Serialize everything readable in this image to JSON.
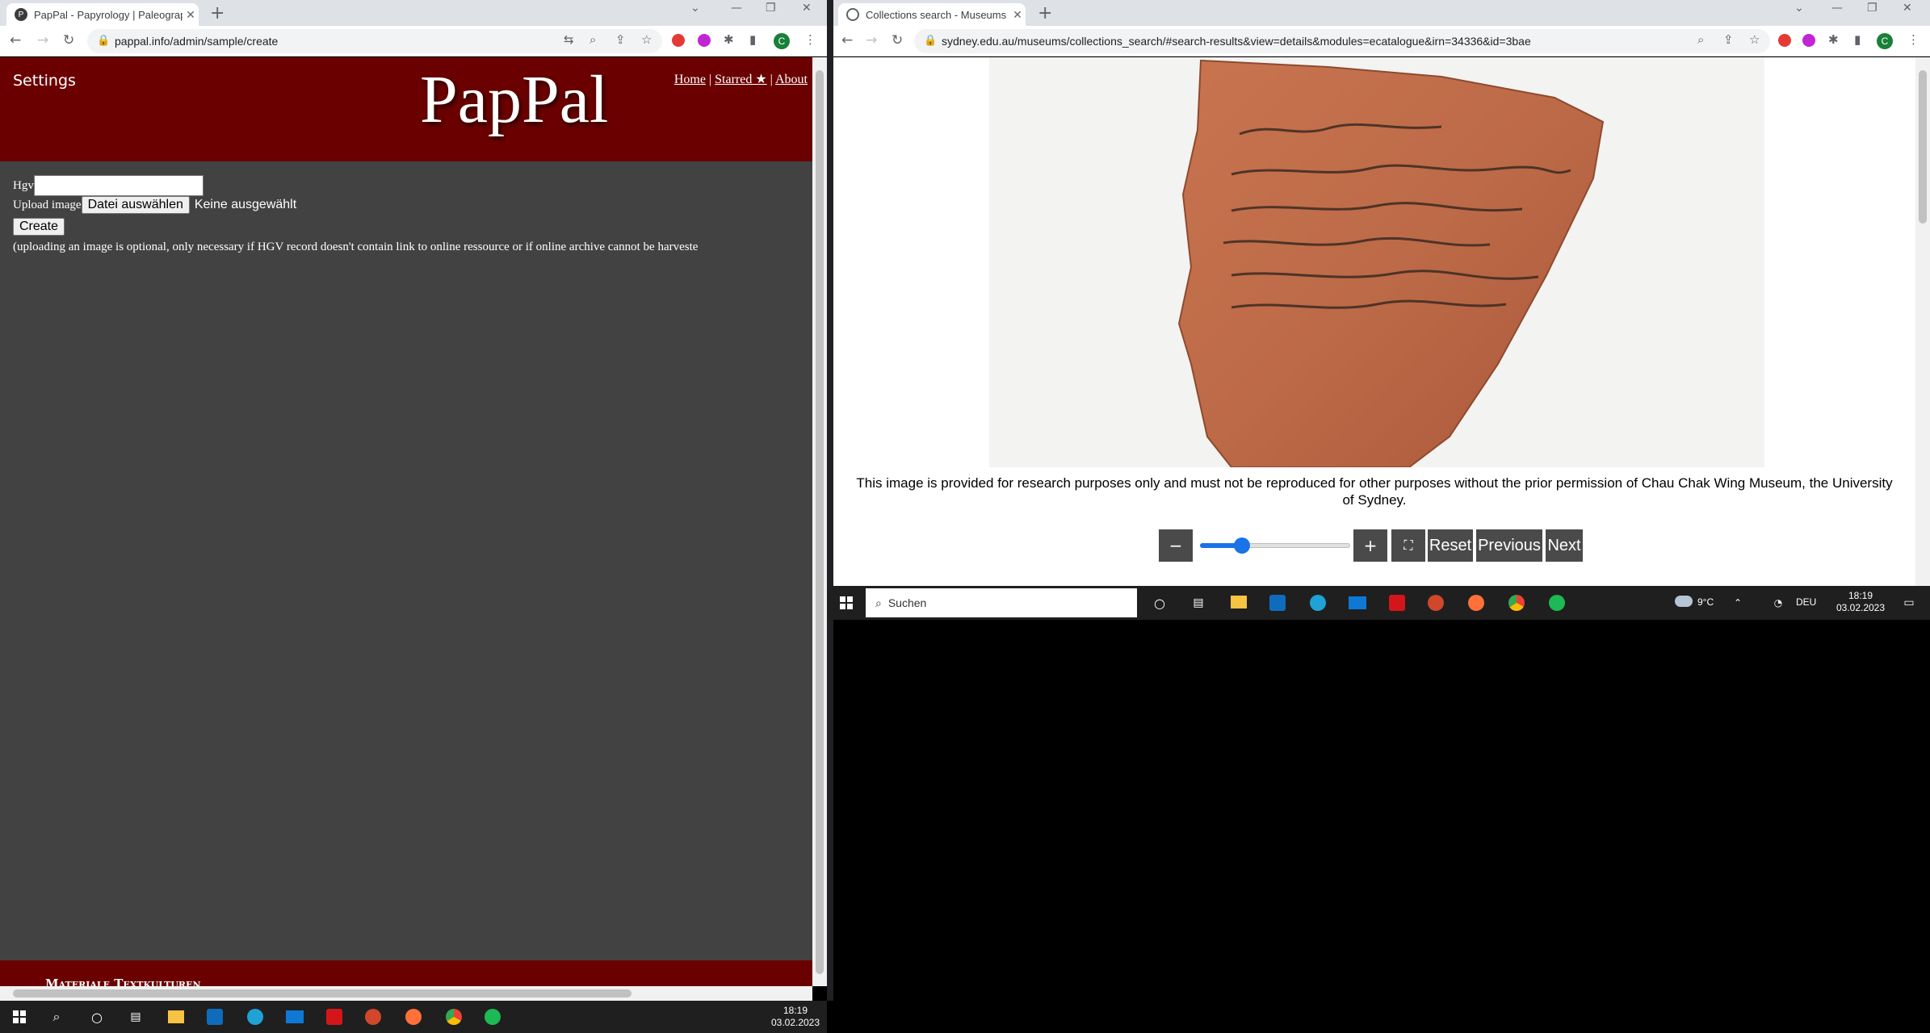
{
  "left_browser": {
    "tab": {
      "title": "PapPal - Papyrology | Paleography",
      "favicon": "pappal-icon"
    },
    "url": "pappal.info/admin/sample/create"
  },
  "right_browser": {
    "tab": {
      "title": "Collections search - Museums - The University of Sydney",
      "favicon": "globe-icon"
    },
    "url": "sydney.edu.au/museums/collections_search/#search-results&view=details&modules=ecatalogue&irn=34336&id=3bae"
  },
  "profile_initial": "C",
  "pappal": {
    "settings": "Settings",
    "logo": "PapPal",
    "nav": {
      "home": "Home",
      "sep1": "|",
      "starred": "Starred ★",
      "sep2": "|",
      "about": "About"
    },
    "form": {
      "hgv_label": "Hgv",
      "hgv_value": "",
      "upload_label": "Upload image",
      "file_button": "Datei auswählen",
      "file_status": "Keine ausgewählt",
      "create_button": "Create",
      "note": "(uploading an image is optional, only necessary if HGV record doesn't contain link to online ressource or if online archive cannot be harveste"
    },
    "footer": "Materiale Textkulturen"
  },
  "museum": {
    "caption": "This image is provided for research purposes only and must not be reproduced for other purposes without the prior permission of Chau Chak Wing Museum, the University of Sydney.",
    "controls": {
      "minus": "−",
      "plus": "+",
      "fullscreen": "⛶",
      "reset": "Reset",
      "previous": "Previous",
      "next": "Next",
      "zoom_fraction": 0.28
    }
  },
  "taskbar_small": {
    "search_placeholder": "Suchen",
    "weather": "9°C",
    "lang": "DEU",
    "time": "18:19",
    "date": "03.02.2023"
  },
  "taskbar_main": {
    "time": "18:19",
    "date": "03.02.2023"
  },
  "colors": {
    "pappal_red": "#6b0000",
    "pappal_body": "#424242",
    "control_gray": "#4a4a4a",
    "slider_blue": "#1a73e8"
  }
}
